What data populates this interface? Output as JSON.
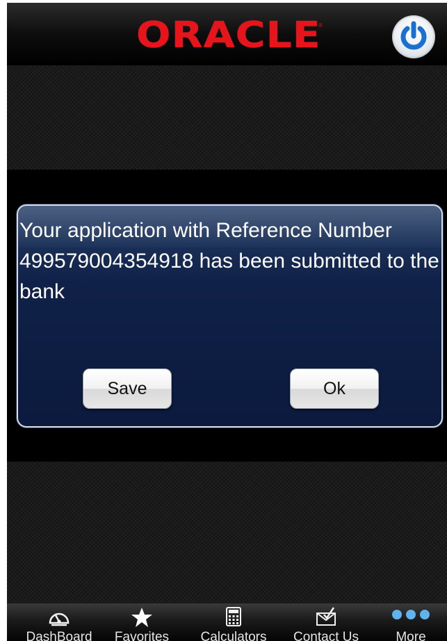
{
  "header": {
    "logo_text": "ORACLE",
    "logo_mark": "®",
    "power_button": {
      "icon": "power-icon"
    }
  },
  "dialog": {
    "message": "Your application with Reference Number 499579004354918 has been submitted to the bank",
    "save_label": "Save",
    "ok_label": "Ok"
  },
  "tabbar": {
    "items": [
      {
        "label": "DashBoard",
        "icon": "dashboard-gauge-icon"
      },
      {
        "label": "Favorites",
        "icon": "star-icon"
      },
      {
        "label": "Calculators",
        "icon": "calculator-icon"
      },
      {
        "label": "Contact Us",
        "icon": "envelope-icon"
      },
      {
        "label": "More",
        "icon": "more-dots-icon"
      }
    ]
  },
  "colors": {
    "brand_red": "#e8141b",
    "dialog_bg": "#0b1a3d",
    "power_blue": "#1a6fd1"
  }
}
